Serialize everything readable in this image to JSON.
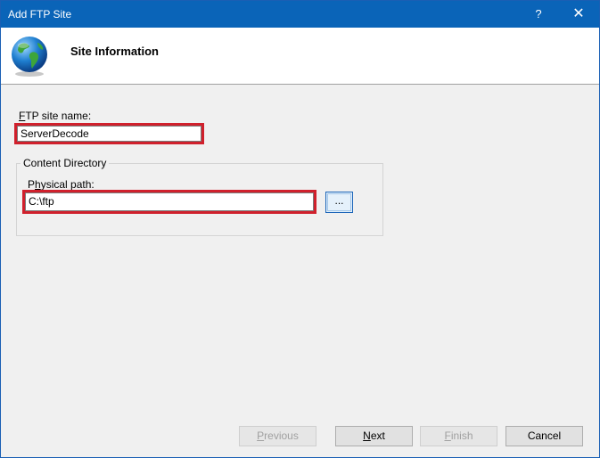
{
  "window": {
    "title": "Add FTP Site",
    "help_glyph": "?",
    "close_glyph": "✕"
  },
  "header": {
    "icon": "globe-icon",
    "heading": "Site Information"
  },
  "form": {
    "site_name_label_accel": "F",
    "site_name_label_rest": "TP site name:",
    "site_name_value": "ServerDecode",
    "content_directory_title": "Content Directory",
    "physical_path_label_pre": "P",
    "physical_path_label_accel": "h",
    "physical_path_label_rest": "ysical path:",
    "physical_path_value": "C:\\ftp",
    "browse_label": "..."
  },
  "footer": {
    "previous_accel": "P",
    "previous_rest": "revious",
    "next_accel": "N",
    "next_rest": "ext",
    "finish_accel": "F",
    "finish_rest": "inish",
    "cancel_label": "Cancel"
  },
  "colors": {
    "titlebar": "#0a64b8",
    "highlight": "#d0202c",
    "dialog_bg": "#f0f0f0"
  }
}
